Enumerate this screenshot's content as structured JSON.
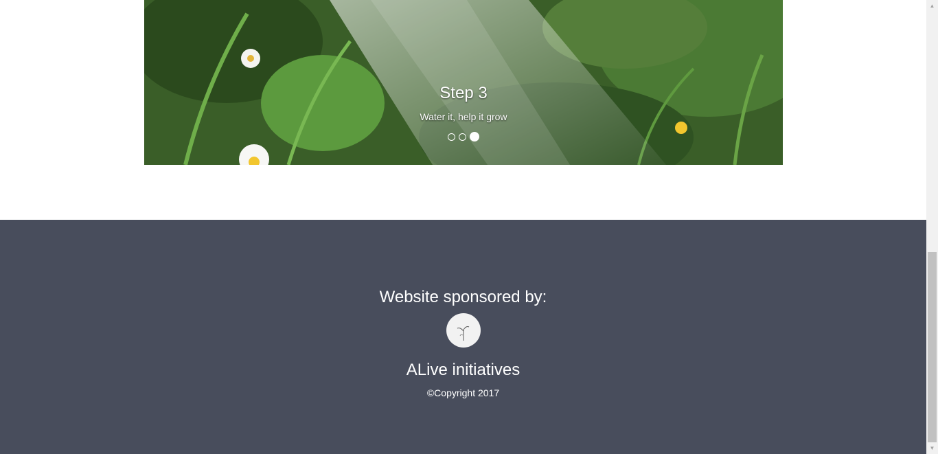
{
  "carousel": {
    "slide_title": "Step 3",
    "slide_text": "Water it, help it grow",
    "active_slide": 3,
    "slide_count": 3
  },
  "footer": {
    "heading": "Website sponsored by:",
    "org_name": "ALive initiatives",
    "copyright": "©Copyright 2017",
    "logo_icon": "sprout-icon",
    "background_color": "#484d5c"
  },
  "scrollbar": {
    "up_icon": "triangle-up-icon",
    "down_icon": "triangle-down-icon"
  }
}
